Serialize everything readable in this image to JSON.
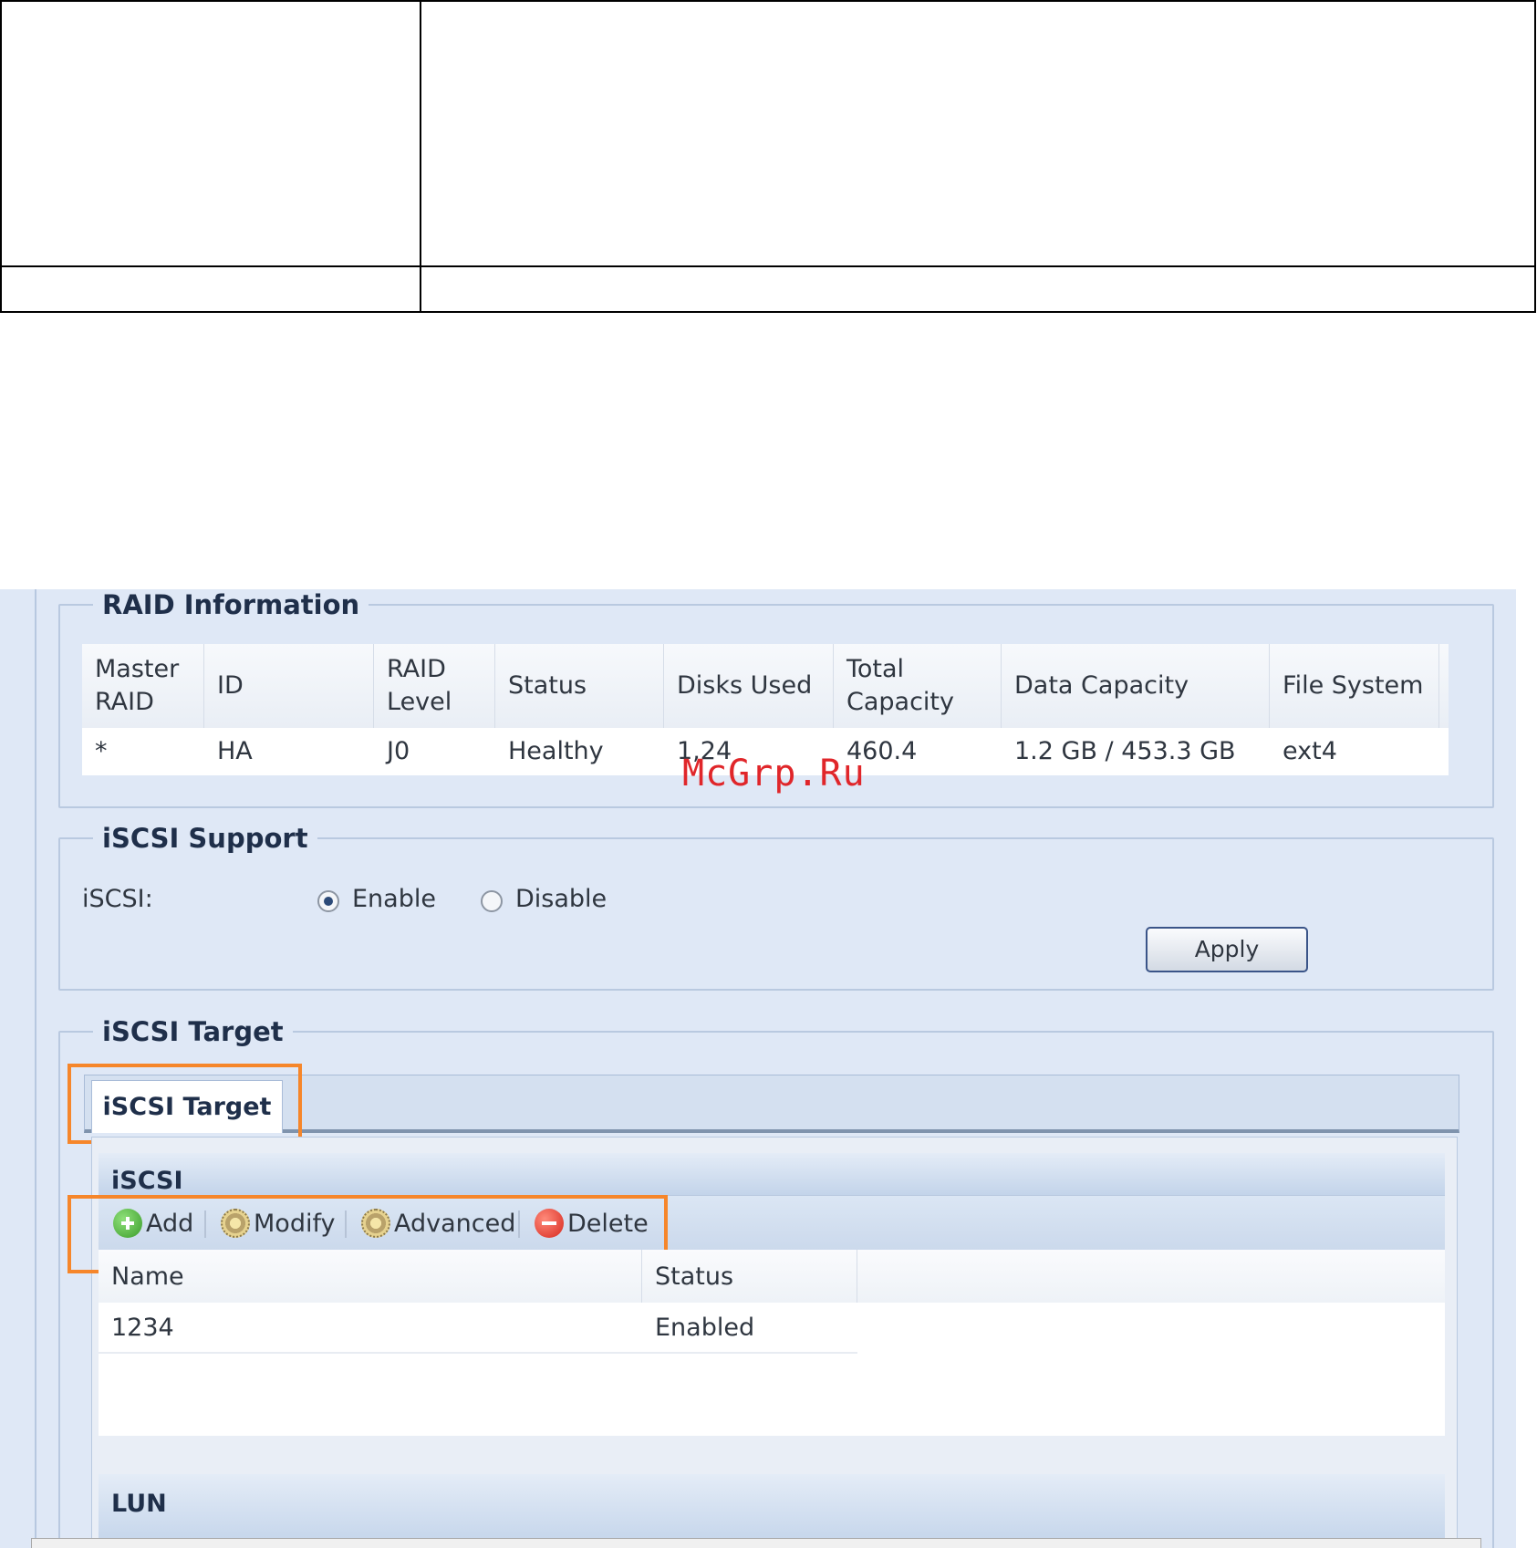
{
  "raid_information": {
    "legend": "RAID Information",
    "headers": [
      "Master RAID",
      "ID",
      "RAID Level",
      "Status",
      "Disks Used",
      "Total Capacity",
      "Data Capacity",
      "File System"
    ],
    "row": [
      "*",
      "HA",
      "J0",
      "Healthy",
      "1,24",
      "460.4",
      "1.2 GB / 453.3 GB",
      "ext4"
    ]
  },
  "iscsi_support": {
    "legend": "iSCSI Support",
    "label": "iSCSI:",
    "options": [
      "Enable",
      "Disable"
    ],
    "selected": "Enable",
    "apply_label": "Apply"
  },
  "iscsi_target": {
    "legend": "iSCSI Target",
    "tab_label": "iSCSI Target",
    "grid_title": "iSCSI",
    "toolbar": {
      "add_label": "Add",
      "modify_label": "Modify",
      "advanced_label": "Advanced",
      "delete_label": "Delete"
    },
    "columns": [
      "Name",
      "Status"
    ],
    "rows": [
      [
        "1234",
        "Enabled"
      ]
    ],
    "lun_title": "LUN"
  },
  "watermark": "McGrp.Ru",
  "colors": {
    "highlight_box": "#f6862a",
    "panel_bg": "#dfe8f6",
    "watermark": "#e0262a"
  },
  "icons": [
    "add-icon",
    "modify-gear-icon",
    "advanced-gear-icon",
    "delete-icon"
  ]
}
